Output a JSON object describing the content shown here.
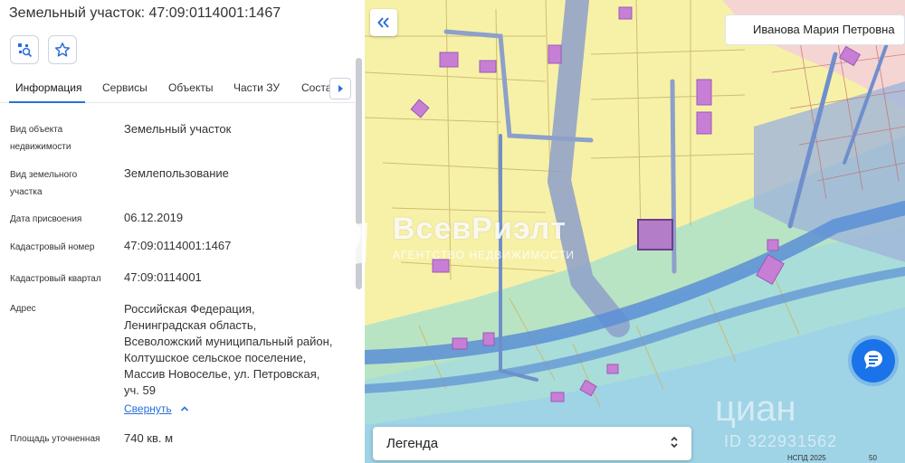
{
  "panel": {
    "title": "Земельный участок: 47:09:0114001:1467",
    "tabs": [
      "Информация",
      "Сервисы",
      "Объекты",
      "Части ЗУ",
      "Соста"
    ],
    "rows": [
      {
        "label": "Вид объекта недвижимости",
        "value": "Земельный участок"
      },
      {
        "label": "Вид земельного участка",
        "value": "Землепользование"
      },
      {
        "label": "Дата присвоения",
        "value": "06.12.2019"
      },
      {
        "label": "Кадастровый номер",
        "value": "47:09:0114001:1467"
      },
      {
        "label": "Кадастровый квартал",
        "value": "47:09:0114001"
      },
      {
        "label": "Адрес",
        "value": "Российская Федерация, Ленинградская область, Всеволожский муниципальный район, Колтушское сельское поселение, Массив Новоселье, ул. Петровская, уч. 59"
      },
      {
        "label": "Площадь уточненная",
        "value": "740 кв. м"
      }
    ],
    "collapse_link": "Свернуть"
  },
  "map": {
    "user_name": "Иванова Мария Петровна",
    "legend_label": "Легенда",
    "footer_credit": "НСПД 2025",
    "scale_label": "50"
  },
  "watermarks": {
    "brand": "ВсевРиэлт",
    "brand_sub": "АГЕНТСТВО НЕДВИЖИМОСТИ",
    "cian": "циан",
    "cian_id": "ID 322931562"
  },
  "colors": {
    "accent": "#2a6fdb",
    "map_yellow": "#f7f1a8",
    "map_teal": "#a8dfd2",
    "map_blue": "#5b8fd6",
    "building": "#c77fd6",
    "selected_parcel": "#8a5fb0"
  }
}
